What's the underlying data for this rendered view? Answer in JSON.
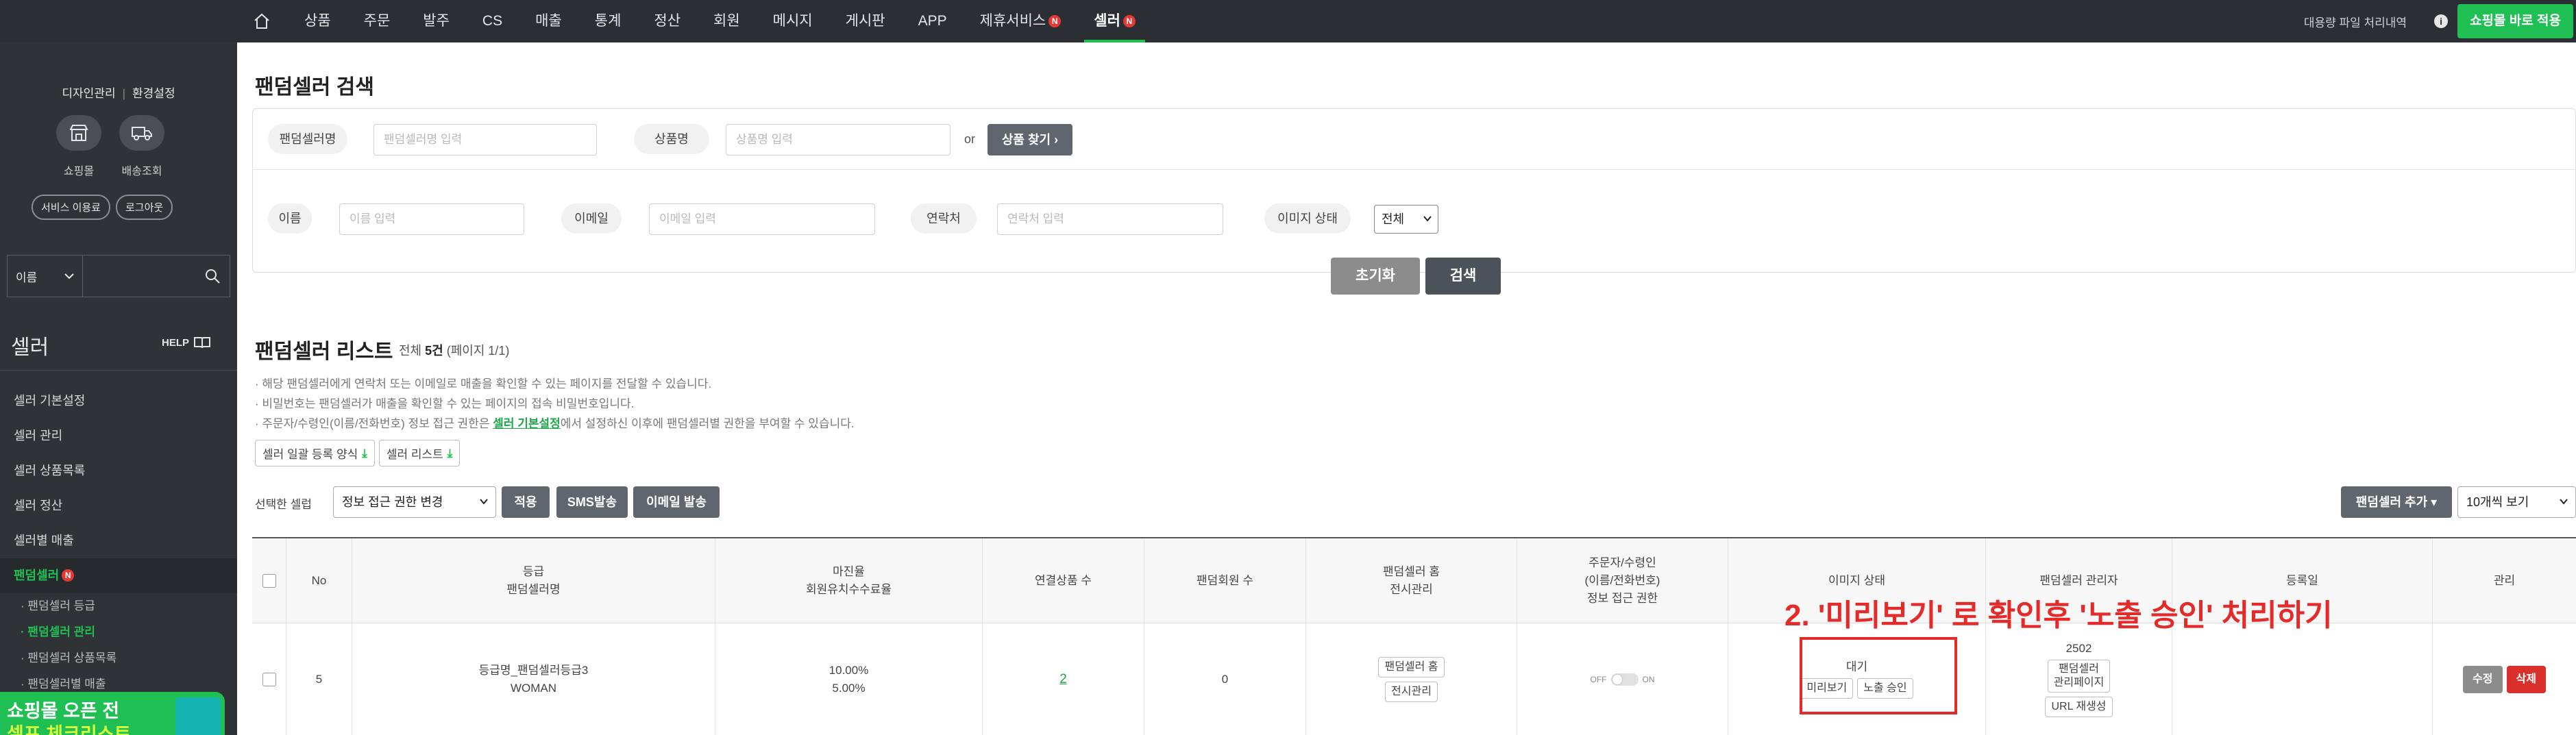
{
  "topnav": {
    "items": [
      {
        "label": "상품"
      },
      {
        "label": "주문"
      },
      {
        "label": "발주"
      },
      {
        "label": "CS"
      },
      {
        "label": "매출"
      },
      {
        "label": "통계"
      },
      {
        "label": "정산"
      },
      {
        "label": "회원"
      },
      {
        "label": "메시지"
      },
      {
        "label": "게시판"
      },
      {
        "label": "APP"
      }
    ],
    "partner": {
      "label": "제휴서비스",
      "badge": "N"
    },
    "seller": {
      "label": "셀러",
      "badge": "N"
    },
    "bulk_file": "대용량 파일 처리내역",
    "info_icon": "i",
    "apply_button": "쇼핑몰 바로 적용"
  },
  "sidebar": {
    "design_link": "디자인관리",
    "settings_link": "환경설정",
    "shop_label": "쇼핑몰",
    "delivery_label": "배송조회",
    "service_usage": "서비스 이용료",
    "logout": "로그아웃",
    "search_select": "이름",
    "section_title": "셀러",
    "help": "HELP",
    "menu": [
      {
        "label": "셀러 기본설정"
      },
      {
        "label": "셀러 관리"
      },
      {
        "label": "셀러 상품목록"
      },
      {
        "label": "셀러 정산"
      },
      {
        "label": "셀러별 매출"
      }
    ],
    "random_seller": {
      "label": "팬덤셀러",
      "badge": "N"
    },
    "submenu": [
      {
        "label": "· 팬덤셀러 등급"
      },
      {
        "label": "· 팬덤셀러 관리"
      },
      {
        "label": "· 팬덤셀러 상품목록"
      },
      {
        "label": "· 팬덤셀러별 매출"
      }
    ],
    "banner_line1": "쇼핑몰 오픈 전",
    "banner_line2": "셀프 체크리스트"
  },
  "search": {
    "title": "팬덤셀러 검색",
    "seller_name_label": "팬덤셀러명",
    "seller_name_placeholder": "팬덤셀러명 입력",
    "product_label": "상품명",
    "product_placeholder": "상품명 입력",
    "or": "or",
    "find_product": "상품 찾기 ›",
    "name_label": "이름",
    "name_placeholder": "이름 입력",
    "email_label": "이메일",
    "email_placeholder": "이메일 입력",
    "phone_label": "연락처",
    "phone_placeholder": "연락처 입력",
    "image_status_label": "이미지 상태",
    "image_status_value": "전체",
    "reset": "초기화",
    "submit": "검색"
  },
  "list": {
    "title": "팬덤셀러 리스트",
    "count_prefix": "전체 ",
    "count_value": "5건",
    "count_suffix": " (페이지 1/1)",
    "note1": "· 해당 팬덤셀러에게 연락처 또는 이메일로 매출을 확인할 수 있는 페이지를 전달할 수 있습니다.",
    "note2": "· 비밀번호는 팬덤셀러가 매출을 확인할 수 있는 페이지의 접속 비밀번호입니다.",
    "note3_prefix": "· 주문자/수령인(이름/전화번호) 정보 접근 권한은 ",
    "note3_link": "셀러 기본설정",
    "note3_suffix": "에서 설정하신 이후에 팬덤셀러별 권한을 부여할 수 있습니다.",
    "bulk_register": "셀러 일괄 등록 양식",
    "seller_list_dl": "셀러 리스트",
    "selected_label": "선택한 셀럽",
    "action_select": "정보 접근 권한 변경",
    "apply": "적용",
    "sms": "SMS발송",
    "email_send": "이메일 발송",
    "add_seller": "팬덤셀러 추가 ▾",
    "per_page": "10개씩 보기"
  },
  "table": {
    "headers": {
      "no": "No",
      "grade_l1": "등급",
      "grade_l2": "팬덤셀러명",
      "margin_l1": "마진율",
      "margin_l2": "회원유치수수료율",
      "linked": "연결상품 수",
      "members": "팬덤회원 수",
      "home_l1": "팬덤셀러 홈",
      "home_l2": "전시관리",
      "access_l1": "주문자/수령인",
      "access_l2": "(이름/전화번호)",
      "access_l3": "정보 접근 권한",
      "image_status": "이미지 상태",
      "manager": "팬덤셀러 관리자",
      "reg_date": "등록일",
      "manage": "관리"
    },
    "rows": [
      {
        "no": "5",
        "grade": "등급명_팬덤셀러등급3",
        "name": "WOMAN",
        "margin": "10.00%",
        "fee": "5.00%",
        "linked": "2",
        "members": "0",
        "home_btn": "팬덤셀러 홈",
        "display_btn": "전시관리",
        "toggle_off": "OFF",
        "toggle_on": "ON",
        "status": "대기",
        "preview_btn": "미리보기",
        "approve_btn": "노출 승인",
        "manager_id": "2502",
        "manager_page_l1": "팬덤셀러",
        "manager_page_l2": "관리페이지",
        "url_regen": "URL 재생성",
        "reg_date": "",
        "edit": "수정",
        "delete": "삭제"
      }
    ]
  },
  "annotation": "2. '미리보기' 로 확인후 '노출 승인' 처리하기",
  "colors": {
    "brand_green": "#1fbf54",
    "annotation_red": "#e52a2a",
    "topbar": "#2b2f33",
    "sidebar": "#2f3336"
  }
}
